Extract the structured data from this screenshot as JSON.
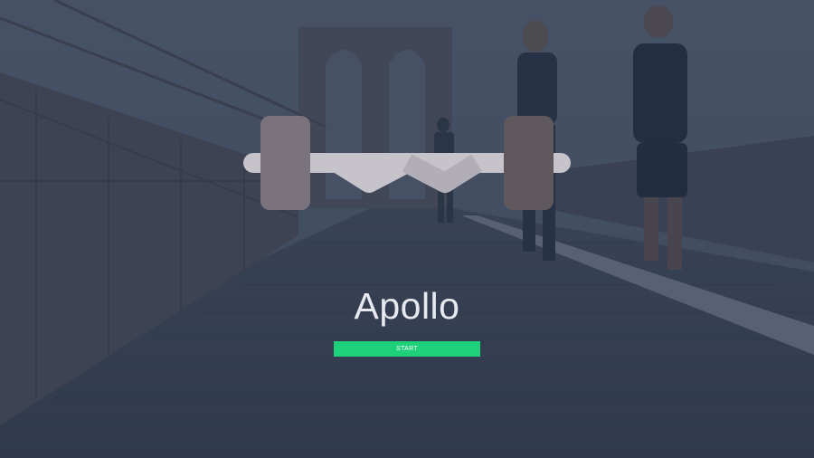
{
  "app": {
    "title": "Apollo",
    "start_label": "START"
  },
  "logo": {
    "icon": "barbell-icon",
    "colors": {
      "left_plate": "#7a727c",
      "right_plate": "#5f585d",
      "bar": "#c6c3cb",
      "bar_shade": "#b2aeb7"
    }
  },
  "theme": {
    "overlay": "#26324a",
    "accent": "#1fd07a",
    "title_color": "#e6e9f0"
  }
}
